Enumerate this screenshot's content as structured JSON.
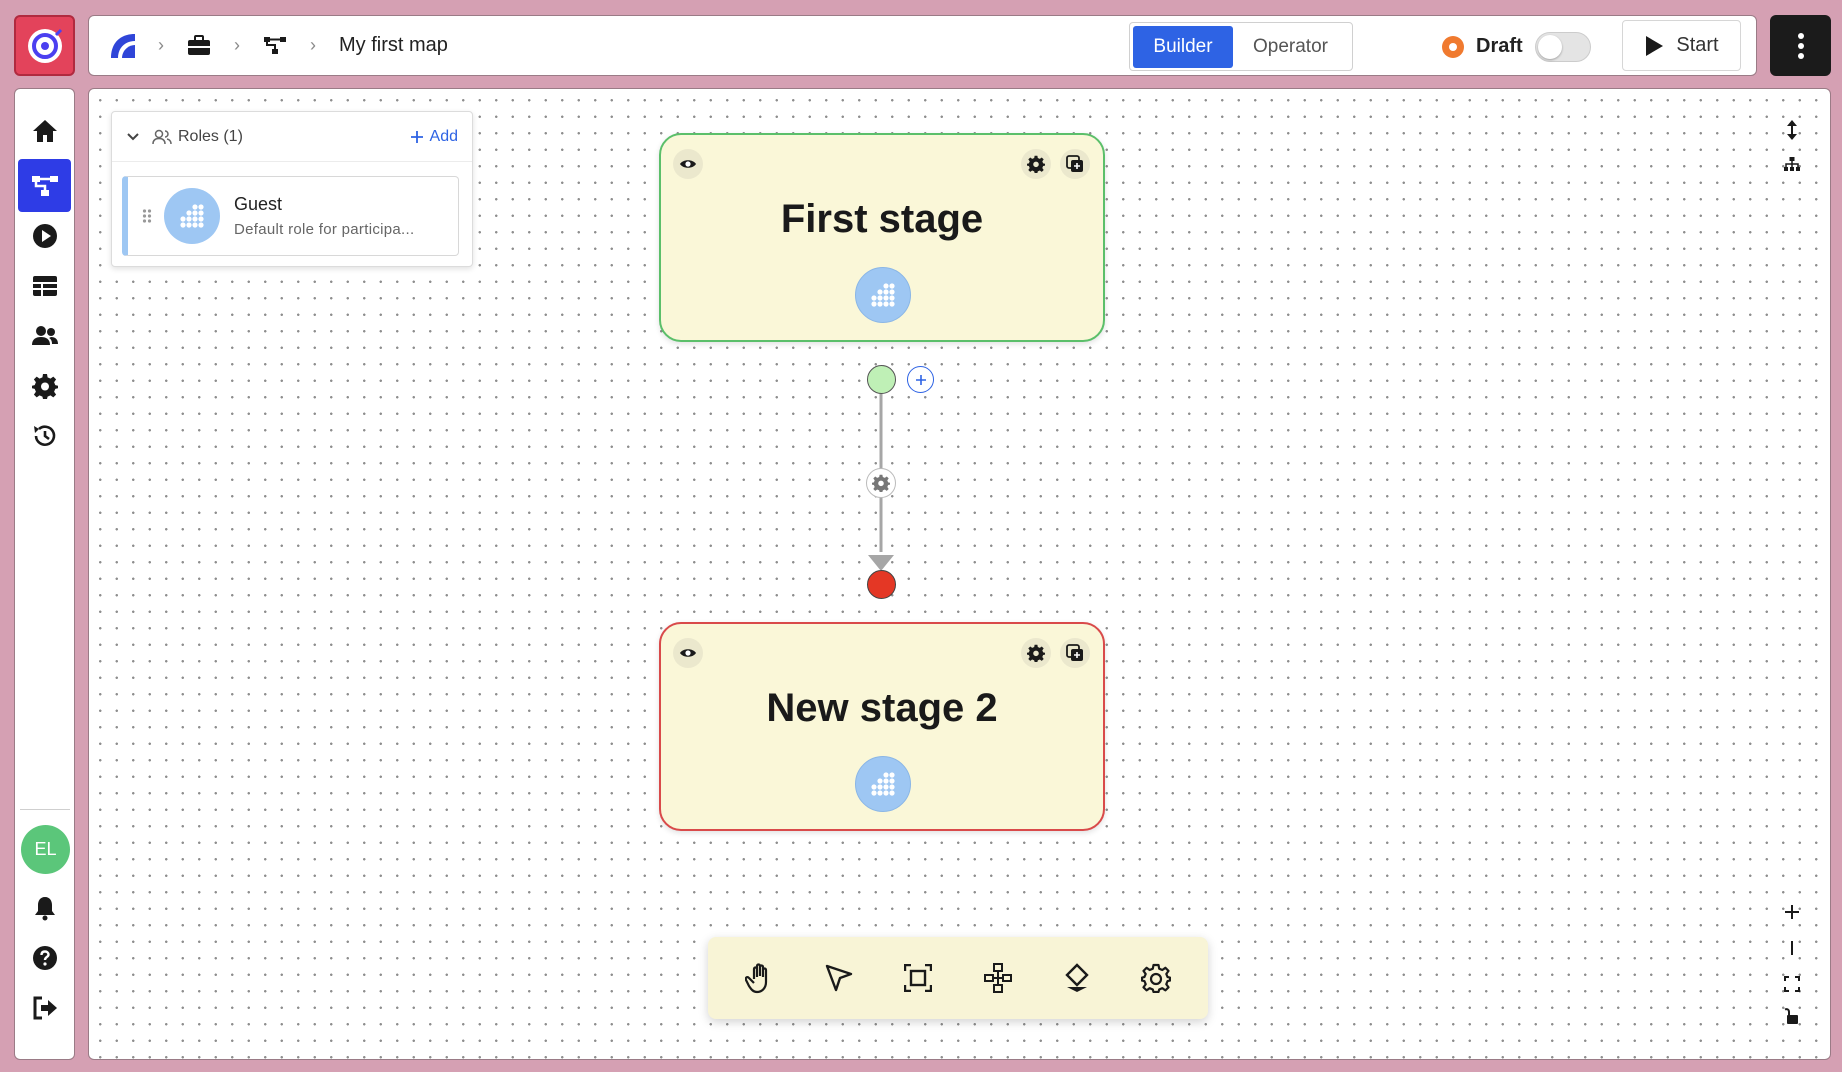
{
  "header": {
    "breadcrumb_title": "My first map",
    "modes": {
      "builder": "Builder",
      "operator": "Operator",
      "active": "Builder"
    },
    "status_label": "Draft",
    "draft_toggle_on": false,
    "start_label": "Start"
  },
  "sidebar": {
    "items": [
      {
        "icon": "home-icon"
      },
      {
        "icon": "map-icon",
        "active": true
      },
      {
        "icon": "play-icon"
      },
      {
        "icon": "table-icon"
      },
      {
        "icon": "users-icon"
      },
      {
        "icon": "gear-icon"
      },
      {
        "icon": "history-icon"
      }
    ],
    "avatar_initials": "EL",
    "bottom_items": [
      {
        "icon": "bell-icon"
      },
      {
        "icon": "help-icon"
      },
      {
        "icon": "logout-icon"
      }
    ]
  },
  "roles_panel": {
    "title": "Roles (1)",
    "add_label": "Add",
    "roles": [
      {
        "name": "Guest",
        "description": "Default role for participa..."
      }
    ]
  },
  "stages": [
    {
      "title": "First stage",
      "status": "start"
    },
    {
      "title": "New stage 2",
      "status": "end"
    }
  ],
  "colors": {
    "accent": "#2e63e4",
    "stage_bg": "#faf7d8",
    "start_green": "#5bbf6a",
    "end_red": "#d94a4a",
    "draft_orange": "#f07a2f",
    "role_blue": "#9ec7f3"
  },
  "toolbar": {
    "tools": [
      "hand-icon",
      "pointer-icon",
      "frame-icon",
      "hierarchy-icon",
      "decision-icon",
      "gear-icon"
    ]
  }
}
